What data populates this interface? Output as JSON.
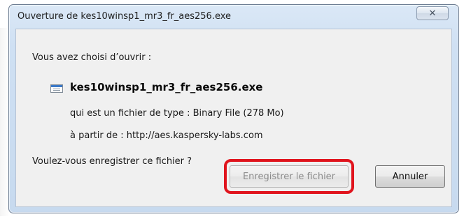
{
  "window": {
    "title": "Ouverture de kes10winsp1_mr3_fr_aes256.exe",
    "close_symbol": "✕"
  },
  "dialog": {
    "heading": "Vous avez choisi d’ouvrir :",
    "file_icon": "file-window-icon",
    "filename": "kes10winsp1_mr3_fr_aes256.exe",
    "type_line": "qui est un fichier de type : Binary File (278 Mo)",
    "from_line": "à partir de : http://aes.kaspersky-labs.com",
    "question": "Voulez-vous enregistrer ce fichier ?",
    "buttons": {
      "save": "Enregistrer le fichier",
      "cancel": "Annuler"
    }
  },
  "colors": {
    "highlight": "#e0141d",
    "title_bar": "#cfe0f3",
    "panel": "#f0f0f0"
  }
}
